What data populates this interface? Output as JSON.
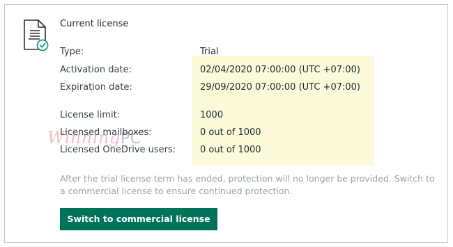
{
  "license": {
    "title": "Current license",
    "details": [
      {
        "label": "Type:",
        "value": "Trial"
      },
      {
        "label": "Activation date:",
        "value": "02/04/2020 07:00:00 (UTC +07:00)"
      },
      {
        "label": "Expiration date:",
        "value": "29/09/2020 07:00:00 (UTC +07:00)"
      }
    ],
    "limits": [
      {
        "label": "License limit:",
        "value": "1000"
      },
      {
        "label": "Licensed mailboxes:",
        "value": "0 out of 1000"
      },
      {
        "label": "Licensed OneDrive users:",
        "value": "0 out of 1000"
      }
    ],
    "note": "After the trial license term has ended, protection will no longer be provided. Switch to a commercial license to ensure continued protection.",
    "switch_button_label": "Switch to commercial license"
  },
  "watermark": {
    "part_a": "Winning",
    "part_b": "PC"
  },
  "icons": {
    "license": "license-document-icon",
    "badge": "check-badge-icon"
  },
  "colors": {
    "accent": "#00735b",
    "badge": "#1a9a7e",
    "highlight": "#fbfbd9",
    "note_text": "#9aa2a6"
  }
}
